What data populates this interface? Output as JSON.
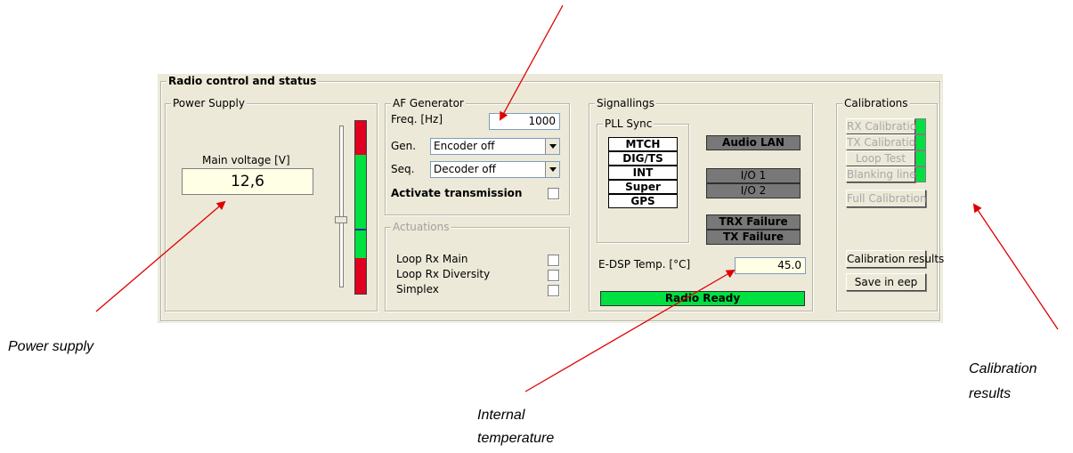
{
  "panel": {
    "title": "Radio control and status",
    "power_supply": {
      "title": "Power Supply",
      "main_voltage_label": "Main voltage [V]",
      "main_voltage_value": "12,6",
      "voltage_level_fraction": 0.67
    },
    "af_generator": {
      "title": "AF Generator",
      "freq_label": "Freq. [Hz]",
      "freq_value": "1000",
      "gen_label": "Gen.",
      "gen_value": "Encoder off",
      "seq_label": "Seq.",
      "seq_value": "Decoder off",
      "activate_label": "Activate transmission"
    },
    "actuations": {
      "title": "Actuations",
      "items": [
        "Loop Rx Main",
        "Loop Rx Diversity",
        "Simplex"
      ]
    },
    "signallings": {
      "title": "Signallings",
      "pll_sync": {
        "title": "PLL Sync",
        "items": [
          "MTCH",
          "DIG/TS",
          "INT",
          "Super",
          "GPS"
        ]
      },
      "audio_lan": "Audio LAN",
      "io1": "I/O 1",
      "io2": "I/O 2",
      "trx_failure": "TRX Failure",
      "tx_failure": "TX Failure",
      "temp_label": "E-DSP Temp. [°C]",
      "temp_value": "45.0",
      "radio_status": "Radio Ready"
    },
    "calibrations": {
      "title": "Calibrations",
      "buttons": [
        "RX Calibration",
        "TX Calibration",
        "Loop Test",
        "Blanking lines"
      ],
      "full_calibration": "Full Calibration",
      "results_button": "Calibration results",
      "save_button": "Save in eep"
    }
  },
  "annotations": {
    "power_supply": "Power supply",
    "internal_temperature_line1": "Internal",
    "internal_temperature_line2": "temperature",
    "calibration_results_line1": "Calibration",
    "calibration_results_line2": "results"
  },
  "colors": {
    "ok_green": "#00e040",
    "alarm_red": "#e00020",
    "arrow_red": "#e00000"
  }
}
